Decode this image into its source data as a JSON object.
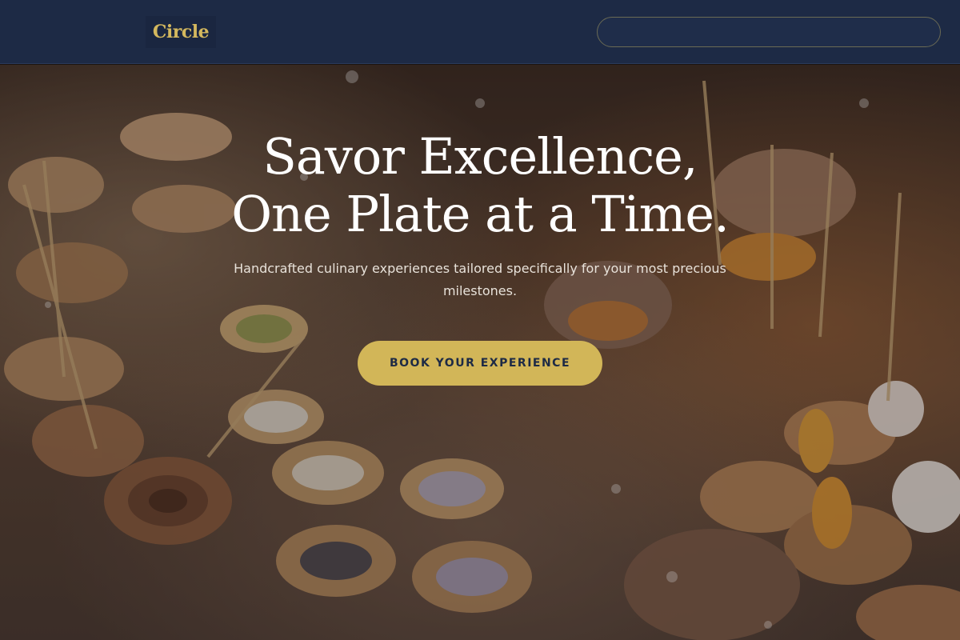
{
  "header": {
    "logo_text": "Circle",
    "background": "#1d2a45",
    "accent": "#d4b85e"
  },
  "hero": {
    "title_line1": "Savor Excellence,",
    "title_line2": "One Plate at a Time.",
    "subtitle": "Handcrafted culinary experiences tailored specifically for your most precious milestones.",
    "cta_label": "BOOK YOUR EXPERIENCE",
    "cta_color": "#d2b658",
    "background_image": "catering-appetizers-photo"
  }
}
